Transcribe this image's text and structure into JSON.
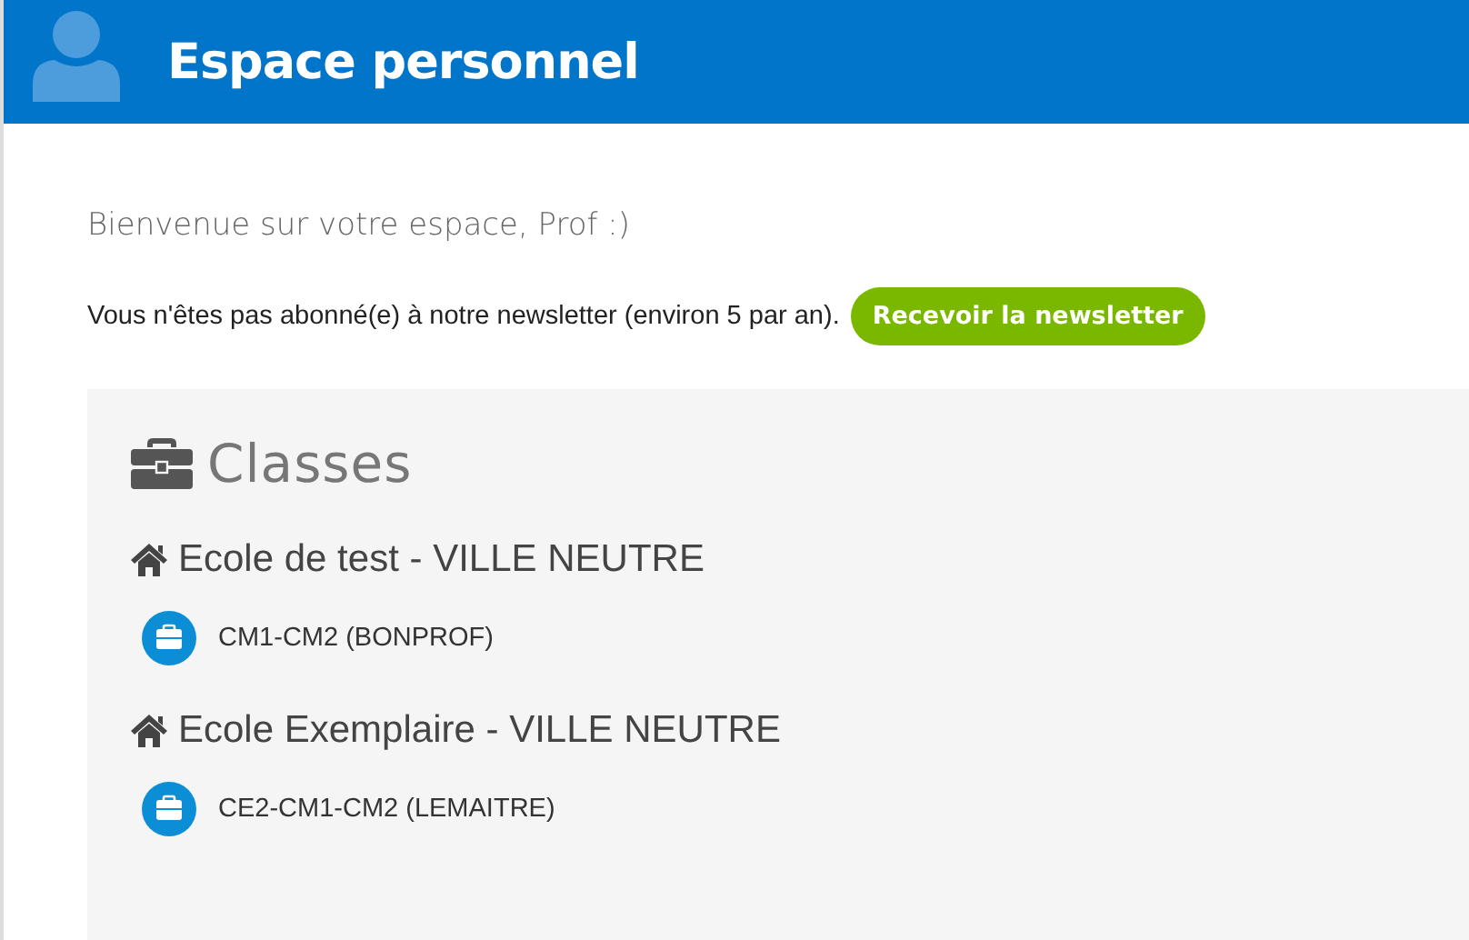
{
  "header": {
    "title": "Espace personnel"
  },
  "welcome": "Bienvenue sur votre espace, Prof :)",
  "newsletter": {
    "text": "Vous n'êtes pas abonné(e) à notre newsletter (environ 5 par an).",
    "button": "Recevoir la newsletter"
  },
  "classes": {
    "title": "Classes",
    "schools": [
      {
        "name": "Ecole de test - VILLE NEUTRE",
        "classes": [
          "CM1-CM2 (BONPROF)"
        ]
      },
      {
        "name": "Ecole Exemplaire - VILLE NEUTRE",
        "classes": [
          "CE2-CM1-CM2 (LEMAITRE)"
        ]
      }
    ]
  }
}
